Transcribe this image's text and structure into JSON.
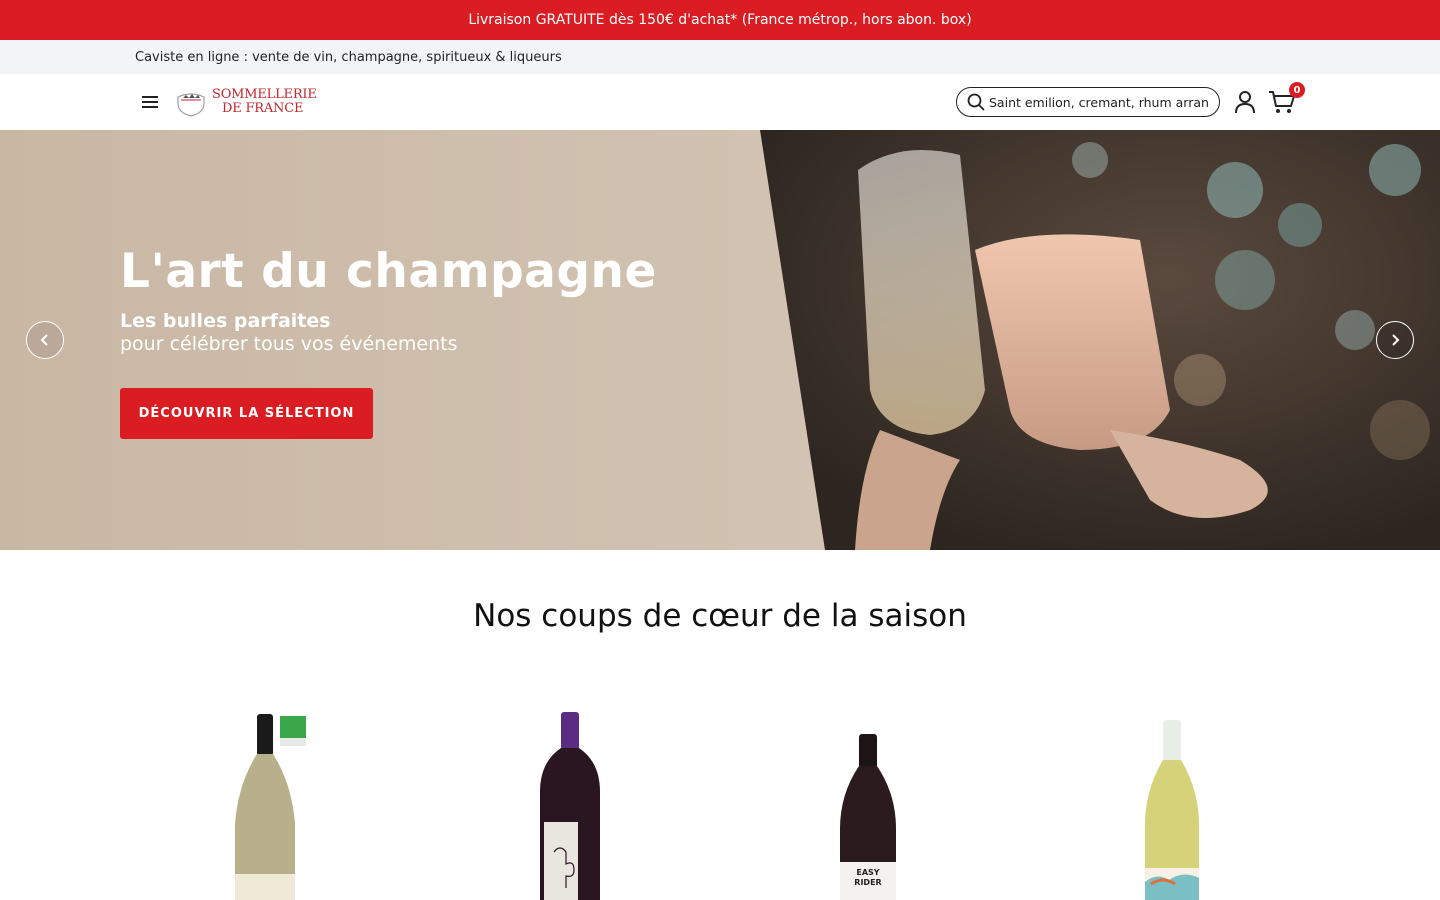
{
  "promo": {
    "text": "Livraison GRATUITE dès 150€ d'achat* (France métrop., hors abon. box)"
  },
  "tagline": {
    "text": "Caviste en ligne : vente de vin, champagne, spiritueux & liqueurs"
  },
  "header": {
    "logo_line1": "SOMMELLERIE",
    "logo_line2": "DE FRANCE",
    "search_placeholder": "Saint emilion, cremant, rhum arrangé",
    "cart_count": "0"
  },
  "hero": {
    "title": "L'art du champagne",
    "subtitle_bold": "Les bulles parfaites",
    "subtitle": "pour célébrer tous vos événements",
    "cta": "DÉCOUVRIR LA SÉLECTION"
  },
  "section": {
    "title": "Nos coups de cœur de la saison"
  },
  "products": [
    {
      "kind": "white-wine",
      "organic": true,
      "label_text": ""
    },
    {
      "kind": "red-wine",
      "organic": false,
      "label_text": ""
    },
    {
      "kind": "red-wine",
      "organic": false,
      "label_text": "EASY RIDER"
    },
    {
      "kind": "white-wine",
      "organic": false,
      "label_text": ""
    }
  ],
  "colors": {
    "brand_red": "#da1d23",
    "tagline_bg": "#f3f4f6"
  }
}
